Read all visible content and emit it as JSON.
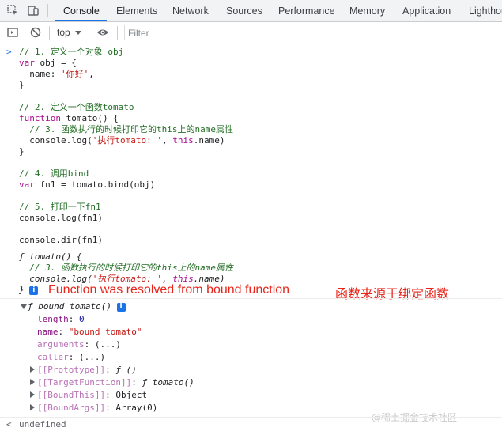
{
  "tabs": [
    {
      "label": "Console",
      "active": true
    },
    {
      "label": "Elements"
    },
    {
      "label": "Network"
    },
    {
      "label": "Sources"
    },
    {
      "label": "Performance"
    },
    {
      "label": "Memory"
    },
    {
      "label": "Application"
    },
    {
      "label": "Lighthouse"
    }
  ],
  "toolbar": {
    "context": "top",
    "filter_placeholder": "Filter"
  },
  "input_code": [
    "// 1. 定义一个对象 obj",
    "var obj = {",
    "  name: '你好',",
    "}",
    "",
    "// 2. 定义一个函数tomato",
    "function tomato() {",
    "  // 3. 函数执行的时候打印它的this上的name属性",
    "  console.log('执行tomato: ', this.name)",
    "}",
    "",
    "// 4. 调用bind",
    "var fn1 = tomato.bind(obj)",
    "",
    "// 5. 打印一下fn1",
    "console.log(fn1)",
    "",
    "console.dir(fn1)"
  ],
  "log_output": {
    "lines": [
      "ƒ tomato() {",
      "  // 3. 函数执行的时候打印它的this上的name属性",
      "  console.log('执行tomato: ', this.name)",
      "}"
    ],
    "info_icon": "i",
    "annotation_english": "Function was resolved from bound function",
    "annotation_chinese": "函数来源于绑定函数"
  },
  "dir_output": {
    "header": "ƒ bound tomato()",
    "props": [
      {
        "key": "length",
        "value": "0"
      },
      {
        "key": "name",
        "value": "\"bound tomato\""
      },
      {
        "key": "arguments",
        "value": "(...)"
      },
      {
        "key": "caller",
        "value": "(...)"
      }
    ],
    "internal": [
      {
        "key": "[[Prototype]]",
        "value": "ƒ ()"
      },
      {
        "key": "[[TargetFunction]]",
        "value": "ƒ tomato()"
      },
      {
        "key": "[[BoundThis]]",
        "value": "Object"
      },
      {
        "key": "[[BoundArgs]]",
        "value": "Array(0)"
      }
    ]
  },
  "result": "undefined",
  "watermark": "@稀土掘金技术社区",
  "colors": {
    "accent": "#1a73e8",
    "comment": "#236e25",
    "keyword": "#aa0d91",
    "string": "#c41a16",
    "annotation": "#e8241a"
  },
  "icons": [
    "inspect-icon",
    "device-toggle-icon",
    "sidebar-toggle-icon",
    "clear-console-icon",
    "eye-icon",
    "info-icon"
  ]
}
